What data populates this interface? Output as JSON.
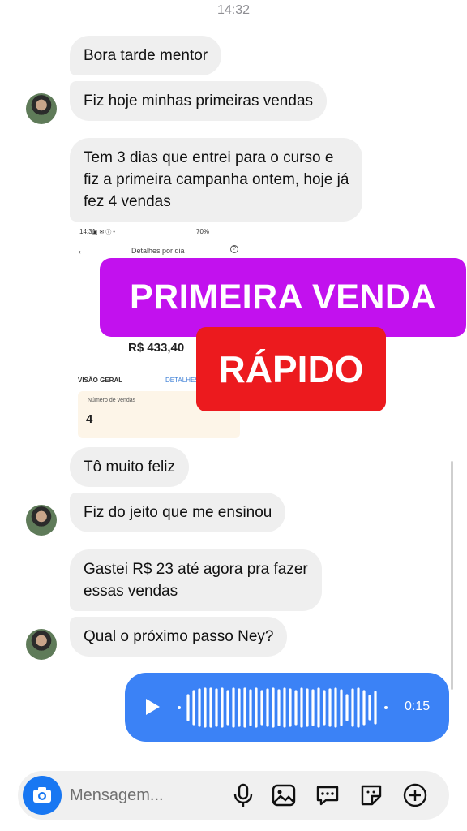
{
  "status": {
    "time": "14:32"
  },
  "messages": {
    "m1": "Bora tarde mentor",
    "m2": "Fiz hoje minhas primeiras vendas",
    "m3": "Tem 3 dias que entrei para o curso e\nfiz a primeira campanha ontem, hoje já\nfez 4 vendas",
    "m4": "Tô muito feliz",
    "m5": "Fiz do jeito que me ensinou",
    "m6": "Gastei R$ 23 até agora pra fazer\nessas vendas",
    "m7": "Qual o próximo passo Ney?"
  },
  "embedded_screenshot": {
    "status_time": "14:31",
    "status_right": "70%",
    "title": "Detalhes por dia",
    "amount": "R$ 433,40",
    "overview_label": "VISÃO GERAL",
    "details_link": "DETALHES",
    "card_label": "Número de vendas",
    "card_value": "4"
  },
  "overlay": {
    "banner_1": "PRIMEIRA VENDA",
    "banner_2": "RÁPIDO",
    "banner_1_color": "#c211ee",
    "banner_2_color": "#ec1a1e"
  },
  "voice_message": {
    "duration": "0:15",
    "color": "#3b82f6"
  },
  "composer": {
    "placeholder": "Mensagem..."
  },
  "icons": [
    "camera-icon",
    "microphone-icon",
    "gallery-icon",
    "chat-bubble-icon",
    "sticker-icon",
    "plus-circle-icon"
  ]
}
